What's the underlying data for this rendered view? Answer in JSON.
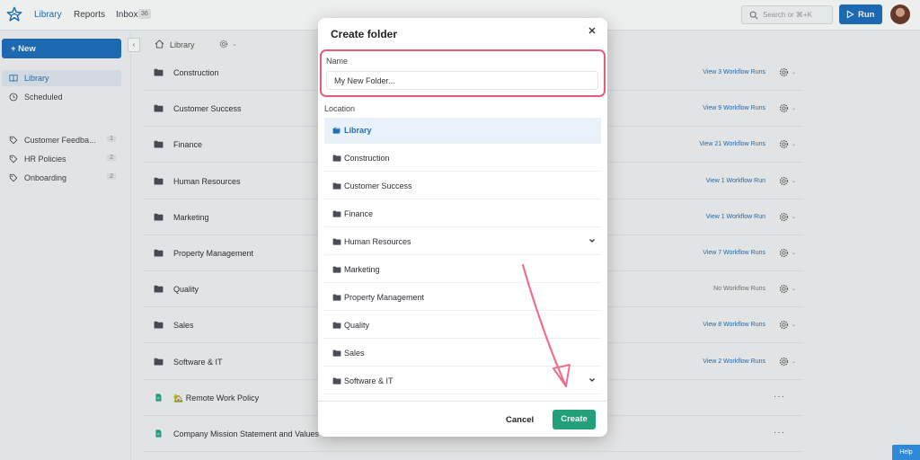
{
  "topbar": {
    "nav": [
      {
        "label": "Library"
      },
      {
        "label": "Reports"
      },
      {
        "label": "Inbox"
      }
    ],
    "inbox_count": "36",
    "search_placeholder": "Search or ⌘+K",
    "run_label": "Run"
  },
  "sidebar": {
    "new_label": "+ New",
    "items": [
      {
        "label": "Library",
        "icon": "book-icon"
      },
      {
        "label": "Scheduled",
        "icon": "clock-icon"
      }
    ],
    "tags": [
      {
        "label": "Customer Feedba...",
        "count": "1"
      },
      {
        "label": "HR Policies",
        "count": "2"
      },
      {
        "label": "Onboarding",
        "count": "2"
      }
    ]
  },
  "breadcrumb": {
    "label": "Library"
  },
  "rows": [
    {
      "name": "Construction",
      "runs": "View 3 Workflow Runs"
    },
    {
      "name": "Customer Success",
      "runs": "View 9 Workflow Runs"
    },
    {
      "name": "Finance",
      "runs": "View 21 Workflow Runs"
    },
    {
      "name": "Human Resources",
      "runs": "View 1 Workflow Run"
    },
    {
      "name": "Marketing",
      "runs": "View 1 Workflow Run"
    },
    {
      "name": "Property Management",
      "runs": "View 7 Workflow Runs"
    },
    {
      "name": "Quality",
      "runs": "No Workflow Runs"
    },
    {
      "name": "Sales",
      "runs": "View 8 Workflow Runs"
    },
    {
      "name": "Software & IT",
      "runs": "View 2 Workflow Runs"
    },
    {
      "name": "🏡 Remote Work Policy",
      "runs": ""
    },
    {
      "name": "Company Mission Statement and Values",
      "runs": ""
    }
  ],
  "modal": {
    "title": "Create folder",
    "name_label": "Name",
    "name_value": "My New Folder...",
    "location_label": "Location",
    "locations": [
      {
        "name": "Library"
      },
      {
        "name": "Construction"
      },
      {
        "name": "Customer Success"
      },
      {
        "name": "Finance"
      },
      {
        "name": "Human Resources"
      },
      {
        "name": "Marketing"
      },
      {
        "name": "Property Management"
      },
      {
        "name": "Quality"
      },
      {
        "name": "Sales"
      },
      {
        "name": "Software & IT"
      }
    ],
    "cancel_label": "Cancel",
    "create_label": "Create"
  },
  "help_label": "Help",
  "colors": {
    "brand": "#1d6fbe",
    "create": "#22a07a",
    "highlight": "#e85b7c"
  }
}
